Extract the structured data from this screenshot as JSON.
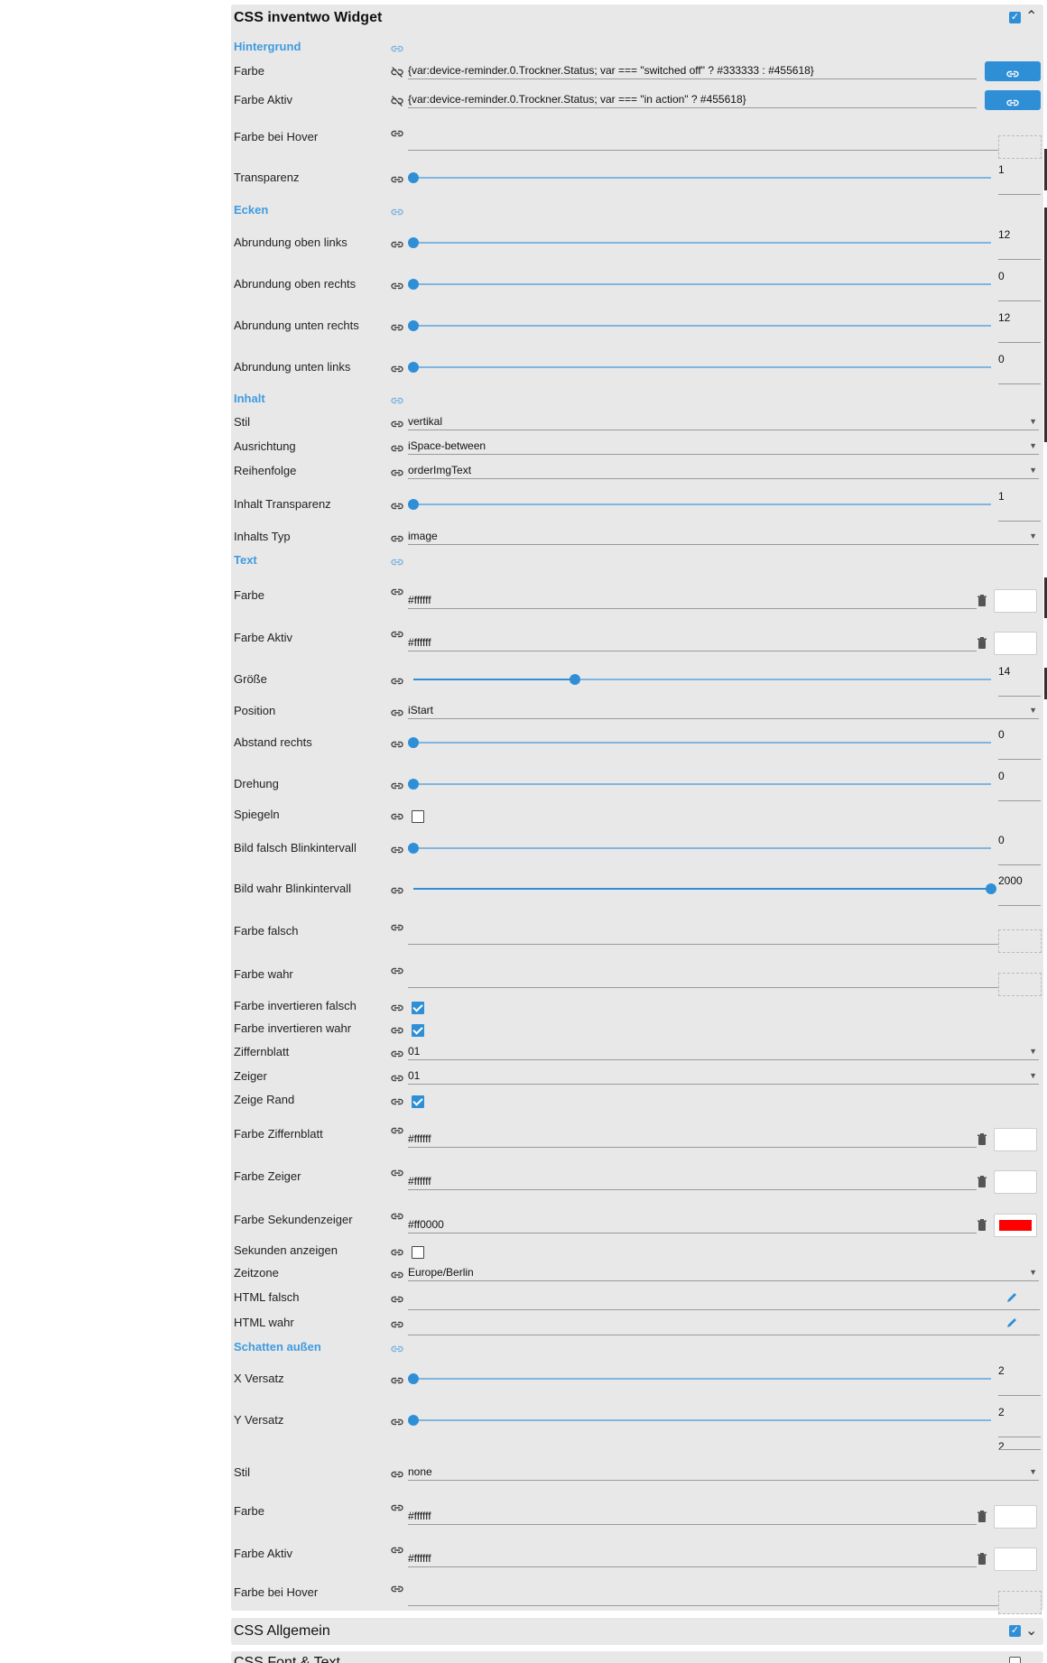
{
  "panel": {
    "title": "CSS inventwo Widget",
    "enabled": true
  },
  "sections": {
    "hintergrund": "Hintergrund",
    "ecken": "Ecken",
    "inhalt": "Inhalt",
    "text": "Text",
    "schatten": "Schatten außen"
  },
  "rows": {
    "farbe": {
      "label": "Farbe",
      "value": "{var:device-reminder.0.Trockner.Status; var === \"switched off\" ? #333333 : #455618}"
    },
    "farbe_aktiv": {
      "label": "Farbe Aktiv",
      "value": "{var:device-reminder.0.Trockner.Status; var === \"in action\" ? #455618}"
    },
    "farbe_hover": {
      "label": "Farbe bei Hover"
    },
    "transparenz": {
      "label": "Transparenz",
      "value": "1",
      "fraction": 0
    },
    "r_ol": {
      "label": "Abrundung oben links",
      "value": "12",
      "fraction": 0
    },
    "r_or": {
      "label": "Abrundung oben rechts",
      "value": "0",
      "fraction": 0
    },
    "r_ur": {
      "label": "Abrundung unten rechts",
      "value": "12",
      "fraction": 0
    },
    "r_ul": {
      "label": "Abrundung unten links",
      "value": "0",
      "fraction": 0
    },
    "stil": {
      "label": "Stil",
      "value": "vertikal"
    },
    "ausrichtung": {
      "label": "Ausrichtung",
      "value": "iSpace-between"
    },
    "reihenfolge": {
      "label": "Reihenfolge",
      "value": "orderImgText"
    },
    "inhalt_transparenz": {
      "label": "Inhalt Transparenz",
      "value": "1",
      "fraction": 0
    },
    "inhalts_typ": {
      "label": "Inhalts Typ",
      "value": "image"
    },
    "t_farbe": {
      "label": "Farbe",
      "value": "#ffffff",
      "swatch": "#ffffff"
    },
    "t_farbe_aktiv": {
      "label": "Farbe Aktiv",
      "value": "#ffffff",
      "swatch": "#ffffff"
    },
    "groesse": {
      "label": "Größe",
      "value": "14",
      "fraction": 0.28
    },
    "position": {
      "label": "Position",
      "value": "iStart"
    },
    "abstand_rechts": {
      "label": "Abstand rechts",
      "value": "0",
      "fraction": 0
    },
    "drehung": {
      "label": "Drehung",
      "value": "0",
      "fraction": 0
    },
    "spiegeln": {
      "label": "Spiegeln",
      "checked": false
    },
    "bild_falsch_blink": {
      "label": "Bild falsch Blinkintervall",
      "value": "0",
      "fraction": 0
    },
    "bild_wahr_blink": {
      "label": "Bild wahr Blinkintervall",
      "value": "2000",
      "fraction": 1
    },
    "farbe_falsch": {
      "label": "Farbe falsch"
    },
    "farbe_wahr": {
      "label": "Farbe wahr"
    },
    "farbe_inv_falsch": {
      "label": "Farbe invertieren falsch",
      "checked": true
    },
    "farbe_inv_wahr": {
      "label": "Farbe invertieren wahr",
      "checked": true
    },
    "ziffernblatt": {
      "label": "Ziffernblatt",
      "value": "01"
    },
    "zeiger": {
      "label": "Zeiger",
      "value": "01"
    },
    "zeige_rand": {
      "label": "Zeige Rand",
      "checked": true
    },
    "farbe_ziffernblatt": {
      "label": "Farbe Ziffernblatt",
      "value": "#ffffff",
      "swatch": "#ffffff"
    },
    "farbe_zeiger": {
      "label": "Farbe Zeiger",
      "value": "#ffffff",
      "swatch": "#ffffff"
    },
    "farbe_sekundenzeiger": {
      "label": "Farbe Sekundenzeiger",
      "value": "#ff0000",
      "swatch": "#ff0000"
    },
    "sekunden_anzeigen": {
      "label": "Sekunden anzeigen",
      "checked": false
    },
    "zeitzone": {
      "label": "Zeitzone",
      "value": "Europe/Berlin"
    },
    "html_falsch": {
      "label": "HTML falsch"
    },
    "html_wahr": {
      "label": "HTML wahr"
    },
    "x_versatz": {
      "label": "X Versatz",
      "value": "2",
      "fraction": 0
    },
    "y_versatz": {
      "label": "Y Versatz",
      "value": "2",
      "fraction": 0
    },
    "s_extra": {
      "value": "2"
    },
    "s_stil": {
      "label": "Stil",
      "value": "none"
    },
    "s_farbe": {
      "label": "Farbe",
      "value": "#ffffff",
      "swatch": "#ffffff"
    },
    "s_farbe_aktiv": {
      "label": "Farbe Aktiv",
      "value": "#ffffff",
      "swatch": "#ffffff"
    },
    "s_farbe_hover": {
      "label": "Farbe bei Hover"
    }
  },
  "bottom": {
    "allgemein": "CSS Allgemein",
    "font_text": "CSS Font & Text"
  },
  "colors": {
    "accent": "#2f8fd6",
    "section": "#3f9be0",
    "panel": "#e8e8e8"
  }
}
